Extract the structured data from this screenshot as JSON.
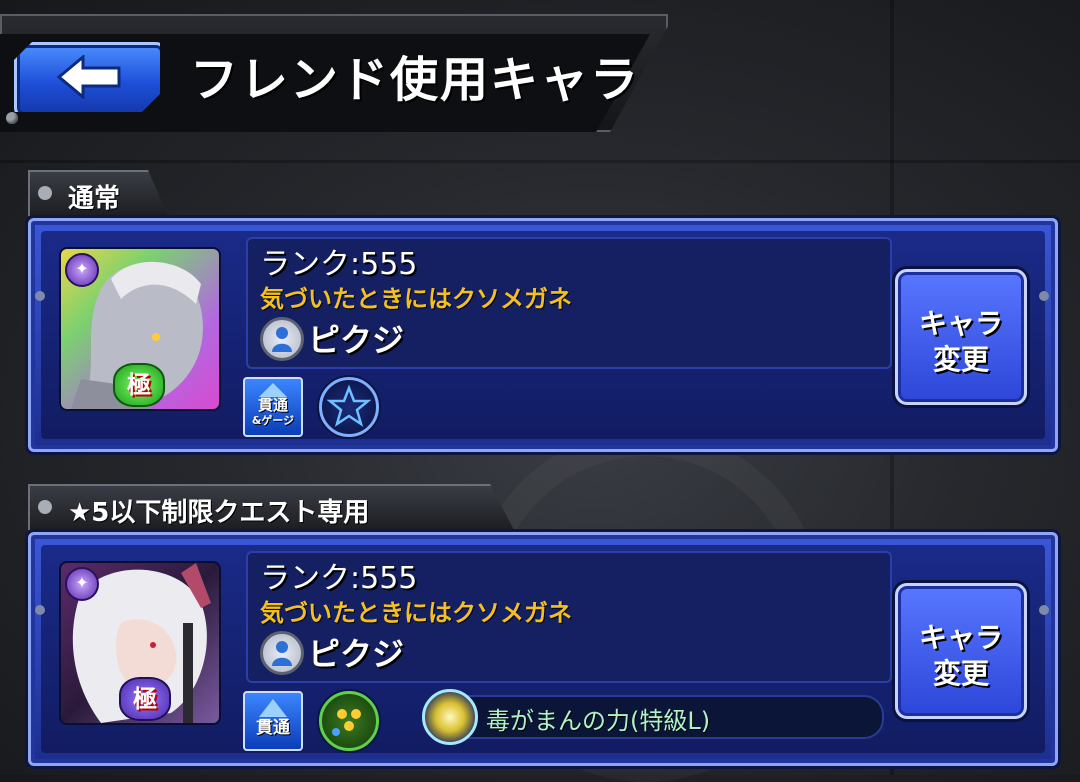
{
  "header": {
    "title": "フレンド使用キャラ",
    "back_icon": "back-arrow-icon"
  },
  "sections": [
    {
      "tab_label": "通常",
      "rank": "ランク:555",
      "comment": "気づいたときにはクソメガネ",
      "username": "ピクジ",
      "badge_label_line1": "貫通",
      "badge_label_line2": "&ゲージ",
      "goku_label": "極",
      "change_button_line1": "キャラ",
      "change_button_line2": "変更",
      "element_icon": "darkness-element-icon",
      "extra_icon": "pentagram-icon",
      "portrait_colors": {
        "primary": "#b0b3c0",
        "accent": "#9a5bd6"
      }
    },
    {
      "tab_label": "★5以下制限クエスト専用",
      "rank": "ランク:555",
      "comment": "気づいたときにはクソメガネ",
      "username": "ピクジ",
      "badge_label_line1": "貫通",
      "goku_label": "極",
      "change_button_line1": "キャラ",
      "change_button_line2": "変更",
      "element_icon": "darkness-element-icon",
      "extra_icon": "green-orb-icon",
      "ability_text": "毒がまんの力(特級L)",
      "ability_icon": "poison-resist-icon",
      "portrait_colors": {
        "primary": "#e6e2ea",
        "accent": "#b24a6a"
      }
    }
  ]
}
